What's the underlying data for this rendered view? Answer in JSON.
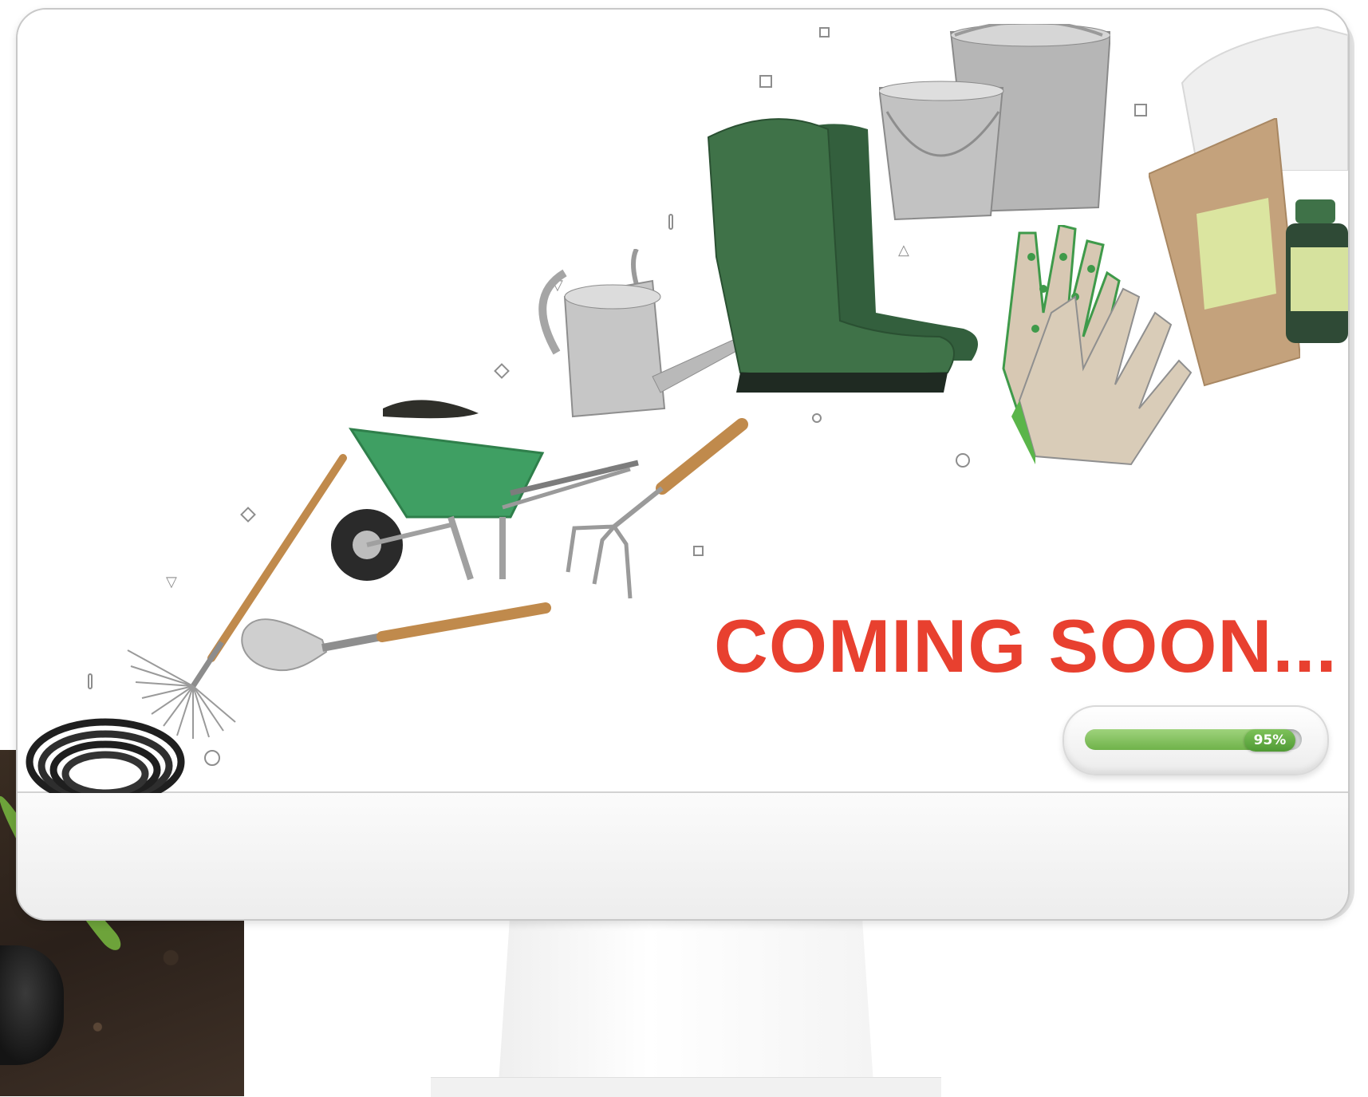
{
  "screen": {
    "heading": "COMING SOON...",
    "progress": {
      "value": 95,
      "label": "95%"
    }
  },
  "colors": {
    "heading": "#e8402f",
    "progress_fill": "#6fb24a",
    "boot_green": "#3f7248"
  },
  "illustration_items": [
    "hose-icon",
    "rake-icon",
    "shovel-icon",
    "wheelbarrow-icon",
    "hand-cultivator-icon",
    "watering-can-icon",
    "garden-trowel-icon",
    "rubber-boots-icon",
    "bucket-icon",
    "gardening-gloves-icon",
    "seed-bag-icon",
    "fertilizer-bottle-icon"
  ]
}
